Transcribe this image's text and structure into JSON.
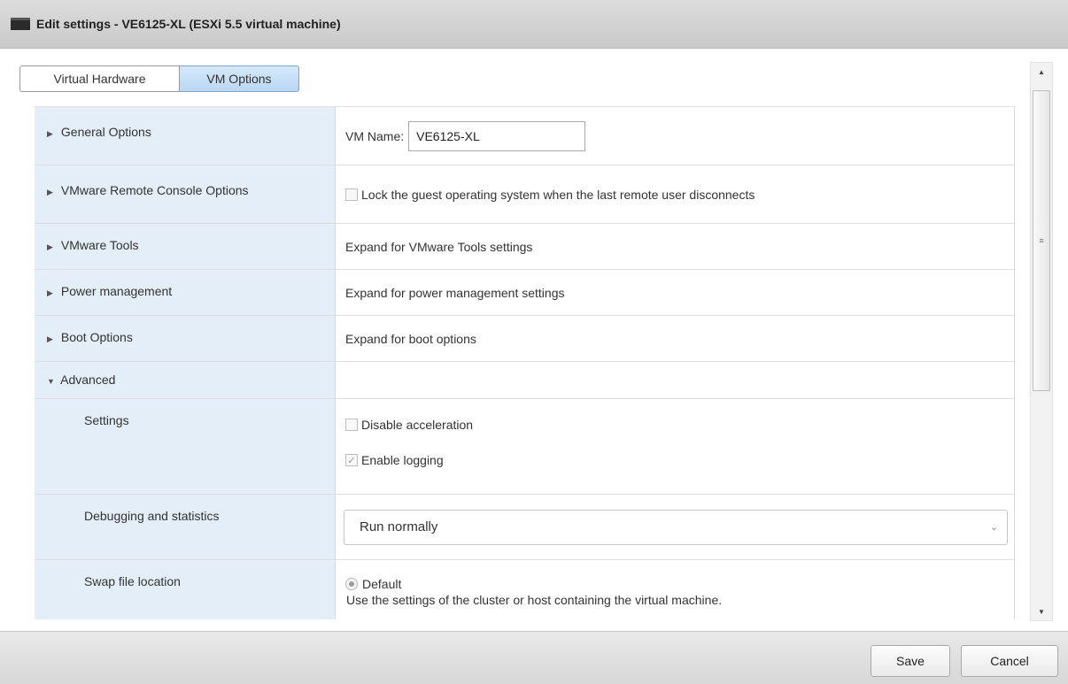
{
  "window": {
    "title": "Edit settings - VE6125-XL (ESXi 5.5 virtual machine)"
  },
  "tabs": [
    {
      "label": "Virtual Hardware",
      "active": false
    },
    {
      "label": "VM Options",
      "active": true
    }
  ],
  "options": {
    "general": {
      "label": "General Options",
      "vm_name_label": "VM Name:",
      "vm_name_value": "VE6125-XL"
    },
    "remote_console": {
      "label": "VMware Remote Console Options",
      "checkbox_label": "Lock the guest operating system when the last remote user disconnects",
      "checked": false
    },
    "tools": {
      "label": "VMware Tools",
      "value": "Expand for VMware Tools settings"
    },
    "power": {
      "label": "Power management",
      "value": "Expand for power management settings"
    },
    "boot": {
      "label": "Boot Options",
      "value": "Expand for boot options"
    },
    "advanced": {
      "label": "Advanced",
      "settings_label": "Settings",
      "disable_acceleration": {
        "label": "Disable acceleration",
        "checked": false
      },
      "enable_logging": {
        "label": "Enable logging",
        "checked": true
      },
      "debugging_label": "Debugging and statistics",
      "debugging_value": "Run normally",
      "swap_label": "Swap file location",
      "swap_default_label": "Default",
      "swap_default_desc": "Use the settings of the cluster or host containing the virtual machine."
    }
  },
  "icons": {
    "collapsed": "triangle-right-icon",
    "expanded": "triangle-down-icon",
    "check": "checkmark-icon",
    "dropdown": "chevron-down-icon"
  },
  "footer": {
    "save_label": "Save",
    "cancel_label": "Cancel"
  },
  "colors": {
    "label_column_bg": "#e4eef8",
    "active_tab_bg": "#b9d7f4",
    "titlebar_bg": "#cfcfcf"
  }
}
